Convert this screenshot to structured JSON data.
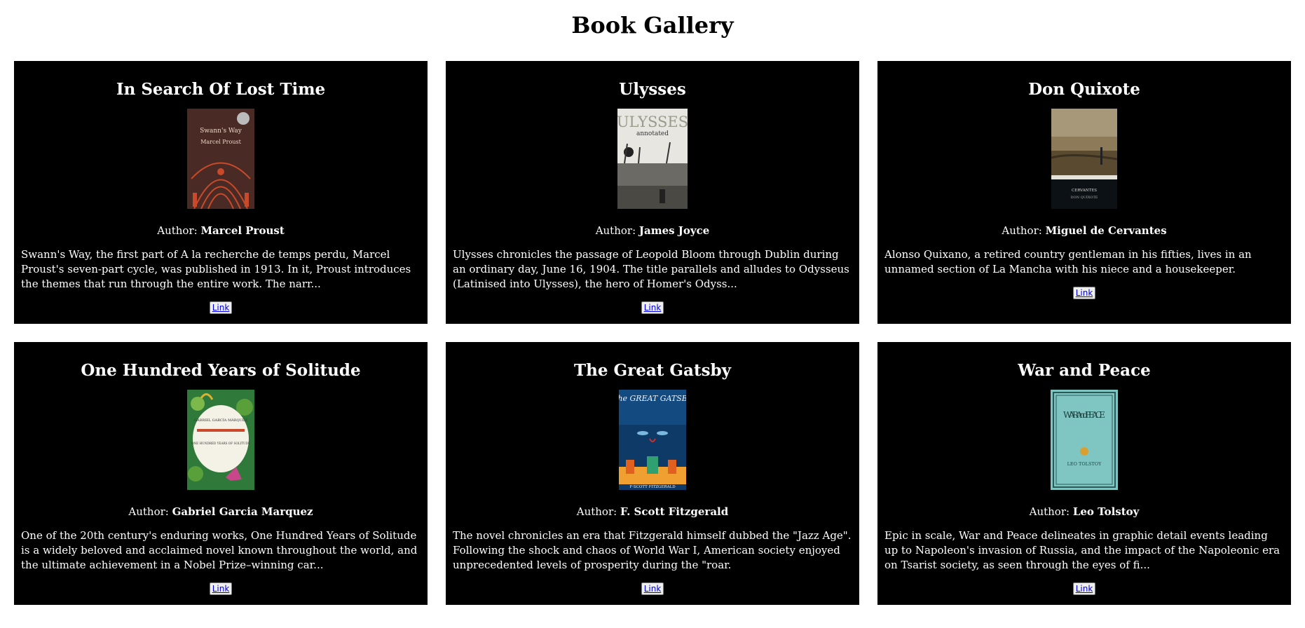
{
  "page": {
    "title": "Book Gallery"
  },
  "author_prefix": "Author: ",
  "books": [
    {
      "title": "In Search Of Lost Time",
      "author": "Marcel Proust",
      "description": "Swann's Way, the first part of A la recherche de temps perdu, Marcel Proust's seven-part cycle, was published in 1913. In it, Proust introduces the themes that run through the entire work. The narr...",
      "link_label": "Link",
      "cover": {
        "line1": "Swann's Way",
        "line2": "Marcel Proust",
        "bg": "#4a2a24",
        "accent": "#c84a2a"
      }
    },
    {
      "title": "Ulysses",
      "author": "James Joyce",
      "description": "Ulysses chronicles the passage of Leopold Bloom through Dublin during an ordinary day, June 16, 1904. The title parallels and alludes to Odysseus (Latinised into Ulysses), the hero of Homer's Odyss...",
      "link_label": "Link",
      "cover": {
        "line1": "ULYSSES",
        "line2": "annotated",
        "bg": "#e8e6e0",
        "accent": "#9a9a8c"
      }
    },
    {
      "title": "Don Quixote",
      "author": "Miguel de Cervantes",
      "description": "Alonso Quixano, a retired country gentleman in his fifties, lives in an unnamed section of La Mancha with his niece and a housekeeper.",
      "link_label": "Link",
      "cover": {
        "line1": "CERVANTES",
        "line2": "DON QUIXOTE",
        "bg": "#6e5a3a",
        "accent": "#0b1114"
      }
    },
    {
      "title": "One Hundred Years of Solitude",
      "author": "Gabriel Garcia Marquez",
      "description": "One of the 20th century's enduring works, One Hundred Years of Solitude is a widely beloved and acclaimed novel known throughout the world, and the ultimate achievement in a Nobel Prize–winning car...",
      "link_label": "Link",
      "cover": {
        "line1": "GABRIEL GARCÍA MÁRQUEZ",
        "line2": "ONE HUNDRED YEARS OF SOLITUDE",
        "bg": "#2f7a3a",
        "accent": "#c8478a"
      }
    },
    {
      "title": "The Great Gatsby",
      "author": "F. Scott Fitzgerald",
      "description": "The novel chronicles an era that Fitzgerald himself dubbed the \"Jazz Age\". Following the shock and chaos of World War I, American society enjoyed unprecedented levels of prosperity during the \"roar.",
      "link_label": "Link",
      "cover": {
        "line1": "The GREAT GATSBY",
        "line2": "F·SCOTT FITZGERALD",
        "bg": "#0d3a66",
        "accent": "#f0a030"
      }
    },
    {
      "title": "War and Peace",
      "author": "Leo Tolstoy",
      "description": "Epic in scale, War and Peace delineates in graphic detail events leading up to Napoleon's invasion of Russia, and the impact of the Napoleonic era on Tsarist society, as seen through the eyes of fi...",
      "link_label": "Link",
      "cover": {
        "line1": "WAR And PEACE",
        "line2": "LEO TOLSTOY",
        "bg": "#7fc6c2",
        "accent": "#2a5a58"
      }
    }
  ]
}
